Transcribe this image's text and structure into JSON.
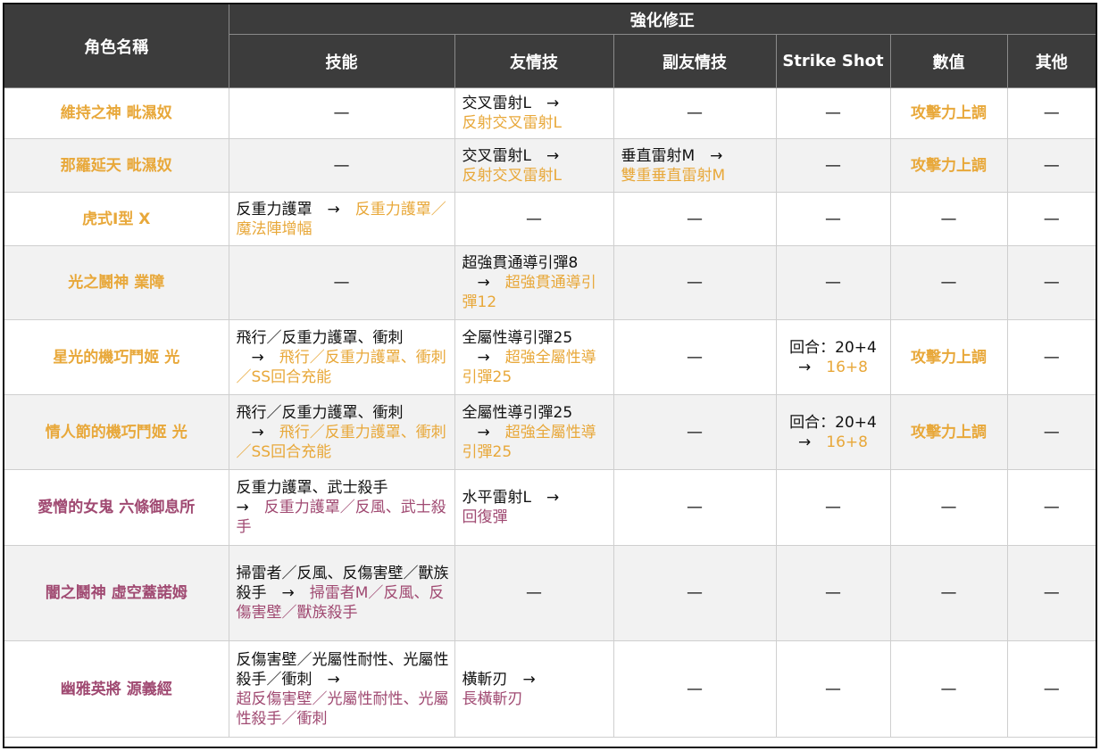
{
  "table": {
    "header_name": "角色名稱",
    "header_group": "強化修正",
    "columns": [
      "技能",
      "友情技",
      "副友情技",
      "Strike Shot",
      "數值",
      "其他"
    ],
    "dash": "—",
    "rows": [
      {
        "name": "維持之神 毗濕奴",
        "skill": {
          "dash": "—"
        },
        "friend": {
          "from": "交叉雷射L　→",
          "to": "反射交叉雷射L"
        },
        "subfriend": {
          "dash": "—"
        },
        "ss": {
          "dash": "—"
        },
        "stat": "攻擊力上調",
        "other": {
          "dash": "—"
        }
      },
      {
        "name": "那羅延天 毗濕奴",
        "skill": {
          "dash": "—"
        },
        "friend": {
          "from": "交叉雷射L　→",
          "to": "反射交叉雷射L"
        },
        "subfriend": {
          "from": "垂直雷射M　→",
          "to": "雙重垂直雷射M"
        },
        "ss": {
          "dash": "—"
        },
        "stat": "攻擊力上調",
        "other": {
          "dash": "—"
        }
      },
      {
        "name": "虎式Ⅰ型 X",
        "skill": {
          "from": "反重力護罩　→",
          "to": "反重力護罩／魔法陣增幅"
        },
        "friend": {
          "dash": "—"
        },
        "subfriend": {
          "dash": "—"
        },
        "ss": {
          "dash": "—"
        },
        "stat_dash": "—",
        "other": {
          "dash": "—"
        }
      },
      {
        "name": "光之鬪神 業障",
        "skill": {
          "dash": "—"
        },
        "friend": {
          "from": "超強貫通導引彈8",
          "to": "超強貫通導引彈12"
        },
        "subfriend": {
          "dash": "—"
        },
        "ss": {
          "dash": "—"
        },
        "stat_dash": "—",
        "other": {
          "dash": "—"
        }
      },
      {
        "name": "星光的機巧鬥姬 光",
        "skill": {
          "from": "飛行／反重力護罩、衝刺",
          "to": "飛行／反重力護罩、衝刺／SS回合充能"
        },
        "friend": {
          "from": "全屬性導引彈25",
          "to": "超強全屬性導引彈25"
        },
        "subfriend": {
          "dash": "—"
        },
        "ss": {
          "from": "回合：20+4",
          "to": "16+8"
        },
        "stat": "攻擊力上調",
        "other": {
          "dash": "—"
        }
      },
      {
        "name": "情人節的機巧鬥姬 光",
        "skill": {
          "from": "飛行／反重力護罩、衝刺",
          "to": "飛行／反重力護罩、衝刺／SS回合充能"
        },
        "friend": {
          "from": "全屬性導引彈25",
          "to": "超強全屬性導引彈25"
        },
        "subfriend": {
          "dash": "—"
        },
        "ss": {
          "from": "回合：20+4",
          "to": "16+8"
        },
        "stat": "攻擊力上調",
        "other": {
          "dash": "—"
        }
      },
      {
        "name": "愛憎的女鬼 六條御息所",
        "skill": {
          "from": "反重力護罩、武士殺手",
          "to": "反重力護罩／反風、武士殺手"
        },
        "friend": {
          "from": "水平雷射L　→",
          "to": "回復彈"
        },
        "subfriend": {
          "dash": "—"
        },
        "ss": {
          "dash": "—"
        },
        "stat_dash": "—",
        "other": {
          "dash": "—"
        }
      },
      {
        "name": "闇之鬪神 虛空蓋諾姆",
        "skill": {
          "from": "掃雷者／反風、反傷害壁／獸族殺手",
          "to": "掃雷者M／反風、反傷害壁／獸族殺手"
        },
        "friend": {
          "dash": "—"
        },
        "subfriend": {
          "dash": "—"
        },
        "ss": {
          "dash": "—"
        },
        "stat_dash": "—",
        "other": {
          "dash": "—"
        }
      },
      {
        "name": "幽雅英將 源義經",
        "skill": {
          "from": "反傷害壁／光屬性耐性、光屬性殺手／衝刺",
          "to": "超反傷害壁／光屬性耐性、光屬性殺手／衝刺"
        },
        "friend": {
          "from": "橫斬刃　→",
          "to": "長橫斬刃"
        },
        "subfriend": {
          "dash": "—"
        },
        "ss": {
          "dash": "—"
        },
        "stat_dash": "—",
        "other": {
          "dash": "—"
        }
      }
    ],
    "arrow": "→",
    "colors": {
      "gold": "#e8a83a",
      "rose": "#a04a72",
      "header_bg": "#3c3c3c",
      "row_alt": "#f2f2f2"
    }
  }
}
